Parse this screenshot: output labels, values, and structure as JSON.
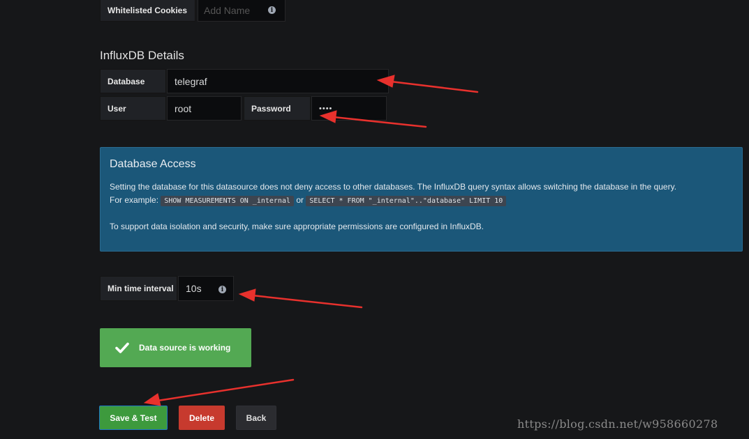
{
  "cookies": {
    "label": "Whitelisted Cookies",
    "placeholder": "Add Name"
  },
  "influx": {
    "title": "InfluxDB Details",
    "database_label": "Database",
    "database_value": "telegraf",
    "user_label": "User",
    "user_value": "root",
    "password_label": "Password",
    "password_value": "••••"
  },
  "access": {
    "title": "Database Access",
    "line1": "Setting the database for this datasource does not deny access to other databases. The InfluxDB query syntax allows switching the database in the query.",
    "for_example": "For example:",
    "code1": "SHOW MEASUREMENTS ON _internal",
    "or": "or",
    "code2": "SELECT * FROM \"_internal\"..\"database\" LIMIT 10",
    "line2": "To support data isolation and security, make sure appropriate permissions are configured in InfluxDB."
  },
  "interval": {
    "label": "Min time interval",
    "value": "10s"
  },
  "status": {
    "message": "Data source is working"
  },
  "buttons": {
    "save": "Save & Test",
    "delete": "Delete",
    "back": "Back"
  },
  "watermark": "https://blog.csdn.net/w958660278",
  "colors": {
    "background": "#161719",
    "success": "#53a953",
    "info_panel": "#1b5779",
    "danger": "#c73a2e",
    "annotation_arrow": "#e8312d"
  }
}
